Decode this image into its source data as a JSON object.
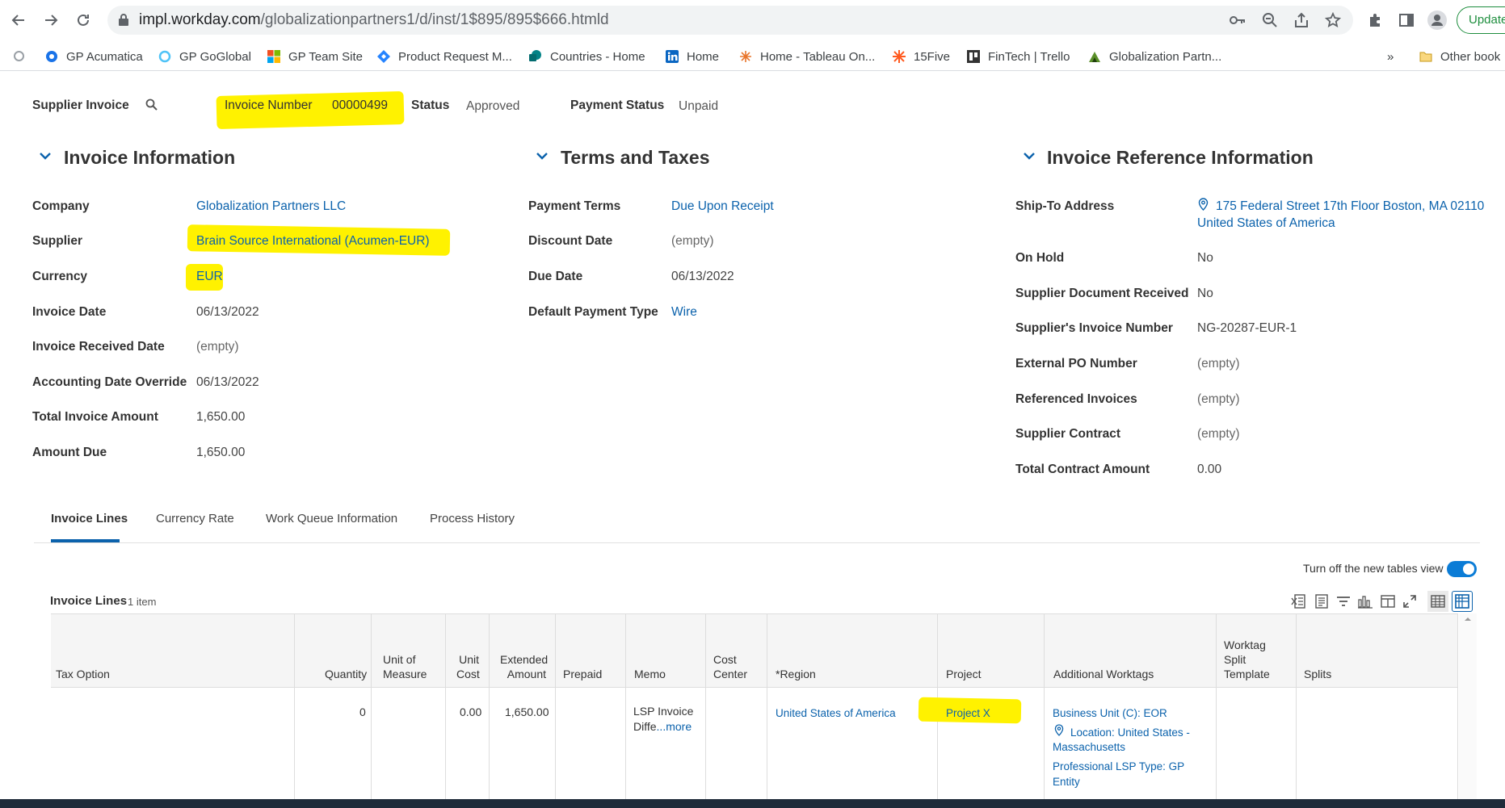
{
  "browser": {
    "url_host": "impl.workday.com",
    "url_path": "/globalizationpartners1/d/inst/1$895/895$666.htmld",
    "update_label": "Update",
    "bookmarks": [
      {
        "label": "GP Acumatica",
        "icon": "acumatica-icon"
      },
      {
        "label": "GP GoGlobal",
        "icon": "ring-icon"
      },
      {
        "label": "GP Team Site",
        "icon": "microsoft-icon"
      },
      {
        "label": "Product Request M...",
        "icon": "diamond-icon"
      },
      {
        "label": "Countries - Home",
        "icon": "sharepoint-icon"
      },
      {
        "label": "Home",
        "icon": "linkedin-icon"
      },
      {
        "label": "Home - Tableau On...",
        "icon": "tableau-icon"
      },
      {
        "label": "15Five",
        "icon": "15five-icon"
      },
      {
        "label": "FinTech | Trello",
        "icon": "trello-icon"
      },
      {
        "label": "Globalization Partn...",
        "icon": "gp-icon"
      }
    ],
    "overflow": "»",
    "other_bookmarks": "Other book"
  },
  "header": {
    "object_type": "Supplier Invoice",
    "invoice_number_label": "Invoice Number",
    "invoice_number": "00000499",
    "status_label": "Status",
    "status": "Approved",
    "payment_status_label": "Payment Status",
    "payment_status": "Unpaid"
  },
  "invoice_info": {
    "title": "Invoice Information",
    "fields": [
      {
        "label": "Company",
        "value": "Globalization Partners LLC"
      },
      {
        "label": "Supplier",
        "value": "Brain Source International (Acumen-EUR)"
      },
      {
        "label": "Currency",
        "value": "EUR"
      },
      {
        "label": "Invoice Date",
        "value": "06/13/2022"
      },
      {
        "label": "Invoice Received Date",
        "value": "(empty)"
      },
      {
        "label": "Accounting Date Override",
        "value": "06/13/2022"
      },
      {
        "label": "Total Invoice Amount",
        "value": "1,650.00"
      },
      {
        "label": "Amount Due",
        "value": "1,650.00"
      }
    ]
  },
  "terms": {
    "title": "Terms and Taxes",
    "fields": [
      {
        "label": "Payment Terms",
        "value": "Due Upon Receipt"
      },
      {
        "label": "Discount Date",
        "value": "(empty)"
      },
      {
        "label": "Due Date",
        "value": "06/13/2022"
      },
      {
        "label": "Default Payment Type",
        "value": "Wire"
      }
    ]
  },
  "reference": {
    "title": "Invoice Reference Information",
    "ship_to_label": "Ship-To Address",
    "ship_to_line1": "175 Federal Street 17th Floor Boston, MA 02110",
    "ship_to_line2": "United States of America",
    "fields": [
      {
        "label": "On Hold",
        "value": "No"
      },
      {
        "label": "Supplier Document Received",
        "value": "No"
      },
      {
        "label": "Supplier's Invoice Number",
        "value": "NG-20287-EUR-1"
      },
      {
        "label": "External PO Number",
        "value": "(empty)"
      },
      {
        "label": "Referenced Invoices",
        "value": "(empty)"
      },
      {
        "label": "Supplier Contract",
        "value": "(empty)"
      },
      {
        "label": "Total Contract Amount",
        "value": "0.00"
      }
    ]
  },
  "tabs": [
    "Invoice Lines",
    "Currency Rate",
    "Work Queue Information",
    "Process History"
  ],
  "lines": {
    "toggle_label": "Turn off the new tables view",
    "title": "Invoice Lines",
    "count": "1 item",
    "columns": {
      "tax_option": "Tax Option",
      "quantity": "Quantity",
      "uom_1": "Unit of",
      "uom_2": "Measure",
      "unit_cost_1": "Unit",
      "unit_cost_2": "Cost",
      "ext_1": "Extended",
      "ext_2": "Amount",
      "prepaid": "Prepaid",
      "memo": "Memo",
      "cc_1": "Cost",
      "cc_2": "Center",
      "region": "*Region",
      "project": "Project",
      "worktags": "Additional Worktags",
      "wst_1": "Worktag",
      "wst_2": "Split",
      "wst_3": "Template",
      "splits": "Splits"
    },
    "row": {
      "quantity": "0",
      "unit_cost": "0.00",
      "extended_amount": "1,650.00",
      "memo_1": "LSP Invoice",
      "memo_2": "Diffe",
      "memo_more": "...more",
      "region": "United States of America",
      "project": "Project X",
      "worktag_1": "Business Unit (C): EOR",
      "worktag_2a": "Location: United States -",
      "worktag_2b": "Massachusetts",
      "worktag_3a": "Professional LSP Type: GP",
      "worktag_3b": "Entity"
    }
  }
}
